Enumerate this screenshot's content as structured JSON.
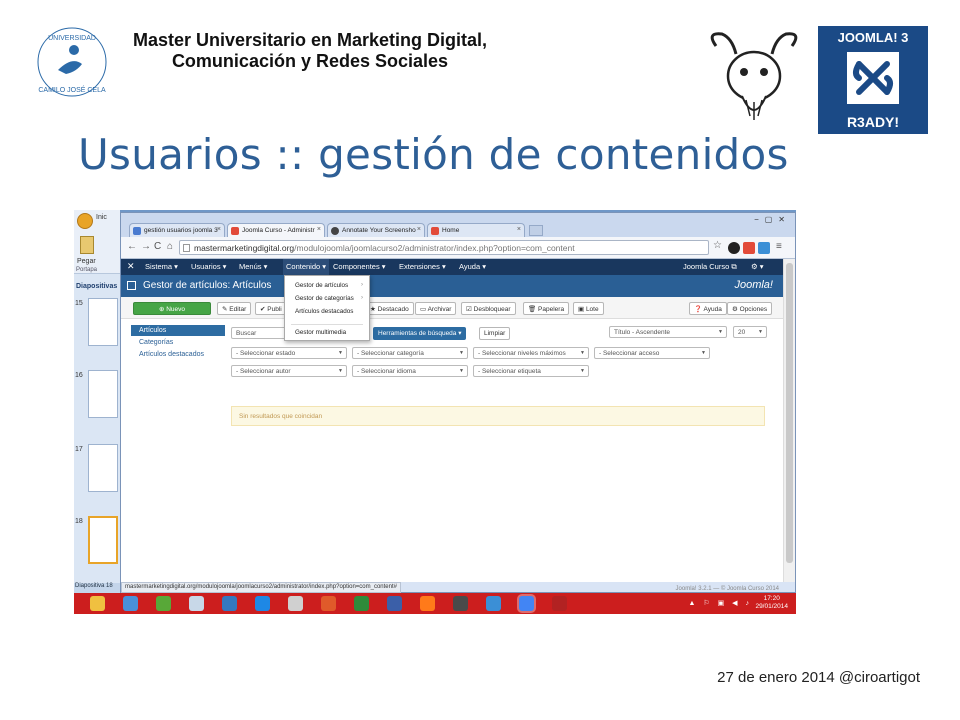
{
  "slide": {
    "university_logo_text": "UNIVERSIDAD CAMILO JOSÉ CELA",
    "master_line1": "Master Universitario en Marketing Digital,",
    "master_line2": "Comunicación y Redes Sociales",
    "joomla_badge_top": "JOOMLA! 3",
    "joomla_badge_bottom": "R3ADY!",
    "title": "Usuarios :: gestión de contenidos",
    "footer": "27 de enero 2014 @ciroartigot"
  },
  "ppt": {
    "tab": "Inic",
    "pegar": "Pegar",
    "portapapeles": "Portapa",
    "panel_label": "Diapositivas",
    "slide_numbers": [
      "15",
      "16",
      "17",
      "18"
    ],
    "status": "Diapositiva 18"
  },
  "browser": {
    "tabs": [
      {
        "label": "gestión usuarios joomla 3",
        "color": "#4a7bd0"
      },
      {
        "label": "Joomla Curso - Administr",
        "color": "#e24b3a"
      },
      {
        "label": "Annotate Your Screensho",
        "color": "#444444"
      },
      {
        "label": "Home",
        "color": "#e24b3a"
      }
    ],
    "url_main": "mastermarketingdigital.org",
    "url_rest": "/modulojoomla/joomlacurso2/administrator/index.php?option=com_content",
    "status_url": "mastermarketingdigital.org/modulojoomla/joomlacurso2/administrator/index.php?option=com_content#"
  },
  "joomla": {
    "menu": [
      "Sistema ▾",
      "Usuarios ▾",
      "Menús ▾",
      "Contenido ▾",
      "Componentes ▾",
      "Extensiones ▾",
      "Ayuda ▾"
    ],
    "site_link": "Joomla Curso ⧉",
    "settings": "⚙ ▾",
    "page_title": "Gestor de artículos: Artículos",
    "logo": "Joomla!",
    "toolbar": {
      "nuevo": "⊕ Nuevo",
      "editar": "✎ Editar",
      "publicar": "✔ Publi",
      "destacado": "★ Destacado",
      "archivar": "▭ Archivar",
      "desbloquear": "☑ Desbloquear",
      "papelera": "🗑 Papelera",
      "lote": "▣ Lote",
      "ayuda": "❓ Ayuda",
      "opciones": "⚙ Opciones"
    },
    "sidebar": [
      "Artículos",
      "Categorías",
      "Artículos destacados"
    ],
    "search_placeholder": "Buscar",
    "search_tools": "Herramientas de búsqueda ▾",
    "clear": "Limpiar",
    "sort": "Título - Ascendente",
    "limit": "20",
    "filters": [
      "- Seleccionar estado",
      "- Seleccionar categoría",
      "- Seleccionar niveles máximos",
      "- Seleccionar acceso",
      "- Seleccionar autor",
      "- Seleccionar idioma",
      "- Seleccionar etiqueta"
    ],
    "no_results": "Sin resultados que coincidan",
    "dropdown": [
      "Gestor de artículos",
      "Gestor de categorías",
      "Artículos destacados",
      "Gestor multimedia"
    ],
    "footer": "Joomla! 3.2.1 — © Joomla Curso 2014"
  },
  "taskbar": {
    "icons": [
      "#f0c040",
      "#4a90d9",
      "#58a838",
      "#c8d8e8",
      "#3478c0",
      "#1e88e5",
      "#d0d0d0",
      "#e05a2a",
      "#2e8b3a",
      "#3b5fa8",
      "#ff7a1a",
      "#4a4a4a",
      "#3b8fd6",
      "#4285f4",
      "#b22222"
    ],
    "clock_time": "17:20",
    "clock_date": "29/01/2014",
    "tray": "▲ ⚐ ▣ ◀ ♪"
  }
}
